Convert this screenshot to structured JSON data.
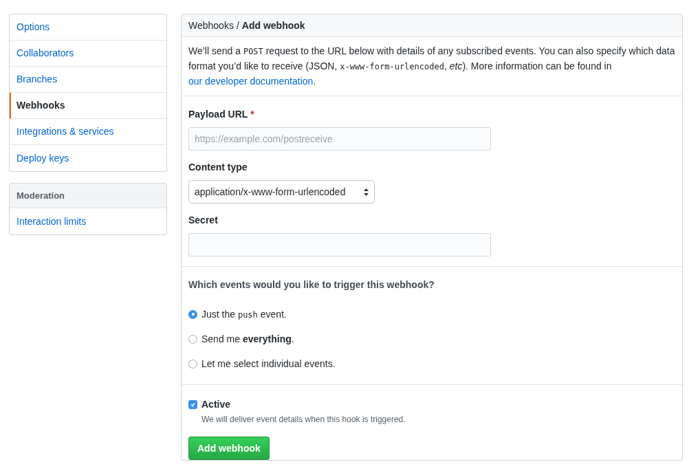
{
  "sidebar": {
    "items": [
      {
        "label": "Options",
        "selected": false
      },
      {
        "label": "Collaborators",
        "selected": false
      },
      {
        "label": "Branches",
        "selected": false
      },
      {
        "label": "Webhooks",
        "selected": true
      },
      {
        "label": "Integrations & services",
        "selected": false
      },
      {
        "label": "Deploy keys",
        "selected": false
      }
    ],
    "moderation": {
      "heading": "Moderation",
      "items": [
        {
          "label": "Interaction limits",
          "selected": false
        }
      ]
    }
  },
  "header": {
    "parent": "Webhooks",
    "separator": "/",
    "title": "Add webhook"
  },
  "intro": [
    {
      "kind": "text",
      "text": "We’ll send a "
    },
    {
      "kind": "code",
      "text": "POST"
    },
    {
      "kind": "text",
      "text": " request to the URL below with details of any subscribed events. You can also specify which data format you’d like to receive (JSON, "
    },
    {
      "kind": "code",
      "text": "x-www-form-urlencoded"
    },
    {
      "kind": "text",
      "text": ", "
    },
    {
      "kind": "italic",
      "text": "etc"
    },
    {
      "kind": "text",
      "text": "). More information can be found in "
    },
    {
      "kind": "link",
      "text": "our developer documentation"
    },
    {
      "kind": "text",
      "text": "."
    }
  ],
  "fields": [
    {
      "kind": "input",
      "label": "Payload URL",
      "required_mark": "*",
      "placeholder": "https://example.com/postreceive"
    },
    {
      "kind": "select",
      "label": "Content type",
      "value": "application/x-www-form-urlencoded"
    },
    {
      "kind": "input",
      "label": "Secret"
    }
  ],
  "events": {
    "question": "Which events would you like to trigger this webhook?",
    "options": [
      {
        "selected": true,
        "label": [
          {
            "kind": "text",
            "text": "Just the "
          },
          {
            "kind": "code",
            "text": "push"
          },
          {
            "kind": "text",
            "text": " event."
          }
        ]
      },
      {
        "selected": false,
        "label": [
          {
            "kind": "text",
            "text": "Send me **everything**."
          }
        ]
      },
      {
        "selected": false,
        "label": [
          {
            "kind": "text",
            "text": "Let me select individual events."
          }
        ]
      }
    ]
  },
  "active": {
    "label": "Active",
    "checked": true,
    "note": "We will deliver event details when this hook is triggered."
  },
  "submit": "Add webhook"
}
